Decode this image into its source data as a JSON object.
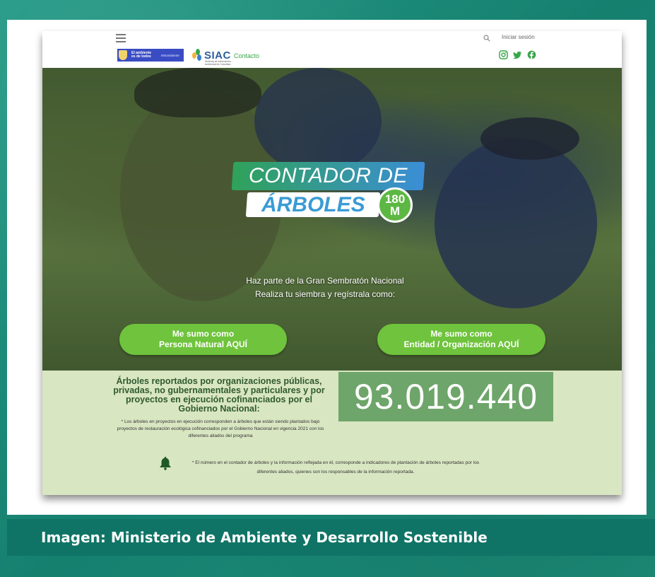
{
  "header": {
    "login_label": "Iniciar sesión",
    "contact_label": "Contacto",
    "gov_logo_text": "El ambiente es de todos",
    "gov_logo_ministry": "Minambiente",
    "siac_logo": "SIAC",
    "siac_subtitle": "Sistema de Información Ambiental de Colombia",
    "social_icons": [
      "instagram-icon",
      "twitter-icon",
      "facebook-icon"
    ]
  },
  "hero": {
    "title_line1": "CONTADOR DE",
    "title_line2": "ÁRBOLES",
    "badge_number": "180",
    "badge_unit": "M",
    "subtitle_line1": "Haz parte de la Gran Sembratón Nacional",
    "subtitle_line2": "Realiza tu siembra y regístrala como:",
    "button_natural_line1": "Me sumo como",
    "button_natural_line2": "Persona Natural AQUÍ",
    "button_entidad_line1": "Me sumo como",
    "button_entidad_line2": "Entidad / Organización AQUÍ"
  },
  "stats": {
    "title": "Árboles reportados por organizaciones públicas, privadas, no gubernamentales y particulares y por proyectos en ejecución cofinanciados por el Gobierno Nacional:",
    "counter_value": "93.019.440",
    "note": "* Los árboles en proyectos en ejecución corresponden a árboles que están siendo plantados bajo proyectos de restauración ecológica cofinanciados por el Gobierno Nacional en vigencia 2021 con los diferentes aliados del programa",
    "disclaimer": "* El número en el contador de árboles y la información reflejada en él, corresponde a indicadores de plantación de árboles reportadas por los diferentes aliados, quienes son los responsables de la información reportada."
  },
  "caption": {
    "text": "Imagen: Ministerio de Ambiente y Desarrollo Sostenible"
  },
  "colors": {
    "accent_green": "#6fc33d",
    "counter_bg": "#6ea56a",
    "stats_bg": "#d9e6c2",
    "caption_bg": "#0f7466"
  }
}
